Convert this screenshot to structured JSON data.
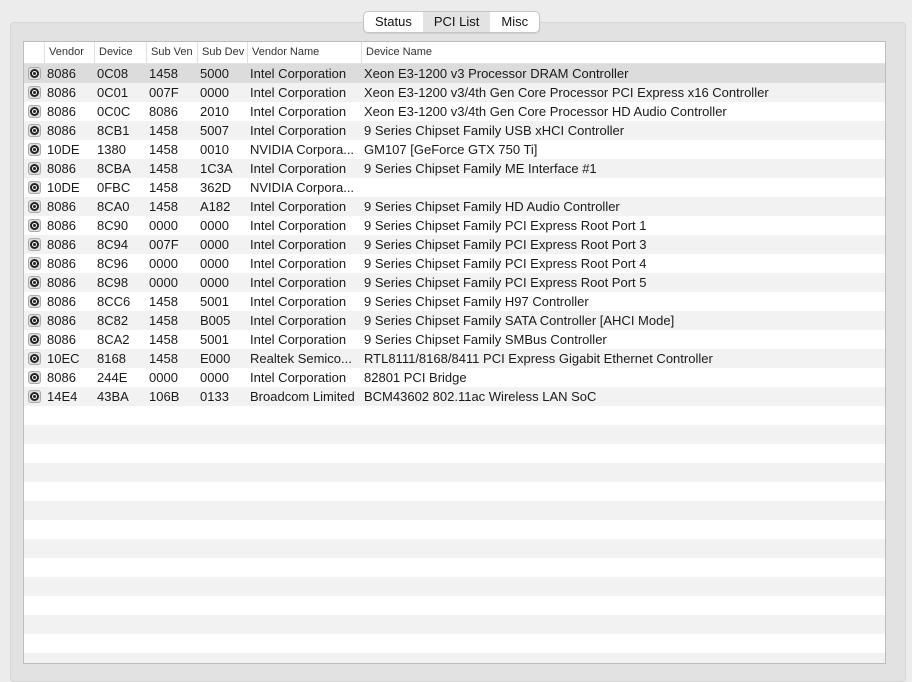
{
  "tabs": [
    {
      "label": "Status",
      "active": false
    },
    {
      "label": "PCI List",
      "active": true
    },
    {
      "label": "Misc",
      "active": false
    }
  ],
  "columns": [
    "Vendor",
    "Device",
    "Sub Ven",
    "Sub Dev",
    "Vendor Name",
    "Device Name"
  ],
  "rows": [
    [
      "8086",
      "0C08",
      "1458",
      "5000",
      "Intel Corporation",
      "Xeon E3-1200 v3 Processor DRAM Controller"
    ],
    [
      "8086",
      "0C01",
      "007F",
      "0000",
      "Intel Corporation",
      "Xeon E3-1200 v3/4th Gen Core Processor PCI Express x16 Controller"
    ],
    [
      "8086",
      "0C0C",
      "8086",
      "2010",
      "Intel Corporation",
      "Xeon E3-1200 v3/4th Gen Core Processor HD Audio Controller"
    ],
    [
      "8086",
      "8CB1",
      "1458",
      "5007",
      "Intel Corporation",
      "9 Series Chipset Family USB xHCI Controller"
    ],
    [
      "10DE",
      "1380",
      "1458",
      "0010",
      "NVIDIA Corpora...",
      "GM107 [GeForce GTX 750 Ti]"
    ],
    [
      "8086",
      "8CBA",
      "1458",
      "1C3A",
      "Intel Corporation",
      "9 Series Chipset Family ME Interface #1"
    ],
    [
      "10DE",
      "0FBC",
      "1458",
      "362D",
      "NVIDIA Corpora...",
      ""
    ],
    [
      "8086",
      "8CA0",
      "1458",
      "A182",
      "Intel Corporation",
      "9 Series Chipset Family HD Audio Controller"
    ],
    [
      "8086",
      "8C90",
      "0000",
      "0000",
      "Intel Corporation",
      "9 Series Chipset Family PCI Express Root Port 1"
    ],
    [
      "8086",
      "8C94",
      "007F",
      "0000",
      "Intel Corporation",
      "9 Series Chipset Family PCI Express Root Port 3"
    ],
    [
      "8086",
      "8C96",
      "0000",
      "0000",
      "Intel Corporation",
      "9 Series Chipset Family PCI Express Root Port 4"
    ],
    [
      "8086",
      "8C98",
      "0000",
      "0000",
      "Intel Corporation",
      "9 Series Chipset Family PCI Express Root Port 5"
    ],
    [
      "8086",
      "8CC6",
      "1458",
      "5001",
      "Intel Corporation",
      "9 Series Chipset Family H97 Controller"
    ],
    [
      "8086",
      "8C82",
      "1458",
      "B005",
      "Intel Corporation",
      "9 Series Chipset Family SATA Controller [AHCI Mode]"
    ],
    [
      "8086",
      "8CA2",
      "1458",
      "5001",
      "Intel Corporation",
      "9 Series Chipset Family SMBus Controller"
    ],
    [
      "10EC",
      "8168",
      "1458",
      "E000",
      "Realtek Semico...",
      "RTL8111/8168/8411 PCI Express Gigabit Ethernet Controller"
    ],
    [
      "8086",
      "244E",
      "0000",
      "0000",
      "Intel Corporation",
      "82801 PCI Bridge"
    ],
    [
      "14E4",
      "43BA",
      "106B",
      "0133",
      "Broadcom Limited",
      "BCM43602 802.11ac Wireless LAN SoC"
    ]
  ],
  "selected_row": 0,
  "row_icon": "magnifier-icon"
}
